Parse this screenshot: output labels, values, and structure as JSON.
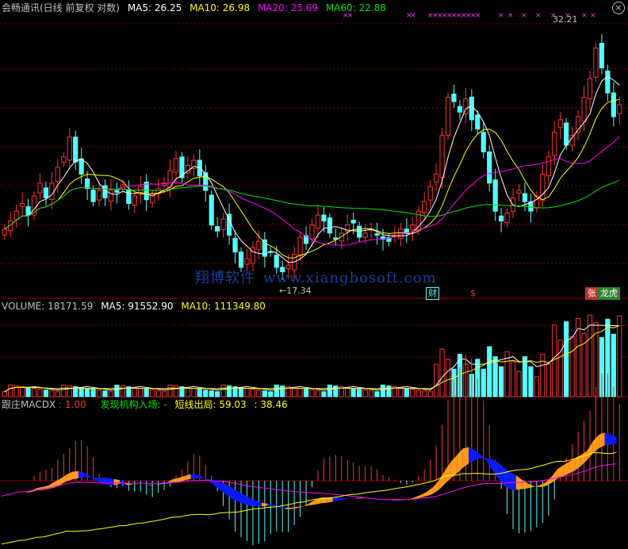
{
  "header": {
    "stock_title": "会畅通讯(日线 前复权 对数)",
    "ma5": "MA5: 26.25",
    "ma10": "MA10: 26.98",
    "ma20": "MA20: 25.69",
    "ma60": "MA60: 22.88"
  },
  "volume_header": {
    "volume": "VOLUME: 18171.59",
    "ma5": "MA5: 91552.90",
    "ma10": "MA10: 111349.80"
  },
  "indicator_header": {
    "name": "跟庄MACDX",
    "value": ": 1.00",
    "signal_label": "发现机构入场: -",
    "exit_label": "短线出局: 59.03",
    "value2": ": 38.46"
  },
  "annotations": {
    "high_price": "32.21",
    "low_price": "17.34",
    "low_arrow": "←",
    "tag_finance": "财",
    "tag_money": "$",
    "tag_up": "张",
    "tag_dragon": "龙虎"
  },
  "watermark": {
    "cn": "翔博软件",
    "url": "www.xiangbosoft.com"
  },
  "colors": {
    "up": "#ff3232",
    "down": "#54fcfc",
    "ma5": "#ffffff",
    "ma10": "#ffff00",
    "ma20": "#ff00ff",
    "ma60": "#00e600",
    "orange": "#ff9a1c",
    "blue": "#0a1cff",
    "grid": "#8b0000"
  },
  "chart_data": {
    "type": "candlestick",
    "scale": "log",
    "high_label_value": 32.21,
    "low_label_value": 17.34,
    "close": [
      19.6,
      20.0,
      20.5,
      20.9,
      20.3,
      21.3,
      22.0,
      21.2,
      22.0,
      22.9,
      23.5,
      24.7,
      23.2,
      22.5,
      21.7,
      21.0,
      21.6,
      21.2,
      21.6,
      21.5,
      21.9,
      20.9,
      21.3,
      21.8,
      21.1,
      21.4,
      21.7,
      22.0,
      22.7,
      23.4,
      22.3,
      23.0,
      23.3,
      22.4,
      21.6,
      19.8,
      19.5,
      20.1,
      19.3,
      18.5,
      17.8,
      18.2,
      18.7,
      19.0,
      18.3,
      18.5,
      17.8,
      17.6,
      17.9,
      18.4,
      19.2,
      18.9,
      19.8,
      20.3,
      20.0,
      19.4,
      19.1,
      19.4,
      19.8,
      19.9,
      19.2,
      19.4,
      19.6,
      19.3,
      19.1,
      19.0,
      19.3,
      19.6,
      19.4,
      19.8,
      20.5,
      21.0,
      21.8,
      22.5,
      24.8,
      27.3,
      27.0,
      26.3,
      27.2,
      25.8,
      25.2,
      23.8,
      22.0,
      20.5,
      20.0,
      20.4,
      21.2,
      21.6,
      21.0,
      20.5,
      21.3,
      22.5,
      23.5,
      25.0,
      25.8,
      24.2,
      24.8,
      26.0,
      27.3,
      28.6,
      30.9,
      29.4,
      27.6,
      26.0,
      26.8
    ]
  }
}
